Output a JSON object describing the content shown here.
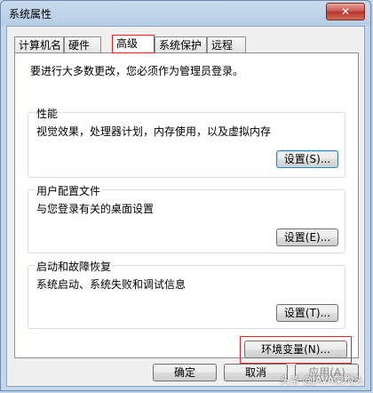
{
  "window": {
    "title": "系统属性",
    "close_glyph": "✕"
  },
  "tabs": [
    {
      "label": "计算机名"
    },
    {
      "label": "硬件"
    },
    {
      "label": "高级"
    },
    {
      "label": "系统保护"
    },
    {
      "label": "远程"
    }
  ],
  "active_tab": "高级",
  "notice": "要进行大多数更改，您必须作为管理员登录。",
  "groups": {
    "performance": {
      "title": "性能",
      "desc": "视觉效果，处理器计划，内存使用，以及虚拟内存",
      "button": "设置(S)..."
    },
    "profiles": {
      "title": "用户配置文件",
      "desc": "与您登录有关的桌面设置",
      "button": "设置(E)..."
    },
    "startup": {
      "title": "启动和故障恢复",
      "desc": "系统启动、系统失败和调试信息",
      "button": "设置(T)..."
    }
  },
  "env_button": "环境变量(N)...",
  "footer": {
    "ok": "确定",
    "cancel": "取消",
    "apply": "应用(A)"
  },
  "watermark": "头条 @JAVA架构头",
  "colors": {
    "highlight": "#d42a2a",
    "titlebar": "#b7cde5"
  }
}
